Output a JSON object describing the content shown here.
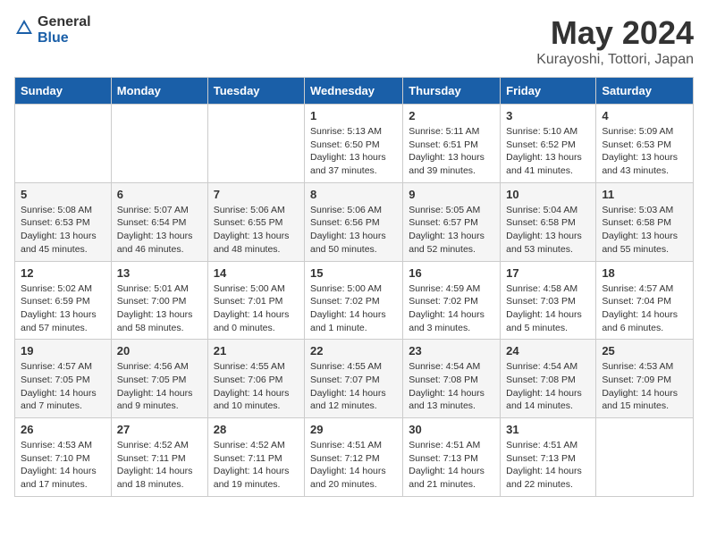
{
  "logo": {
    "general": "General",
    "blue": "Blue"
  },
  "header": {
    "month": "May 2024",
    "location": "Kurayoshi, Tottori, Japan"
  },
  "weekdays": [
    "Sunday",
    "Monday",
    "Tuesday",
    "Wednesday",
    "Thursday",
    "Friday",
    "Saturday"
  ],
  "weeks": [
    [
      {
        "day": "",
        "info": ""
      },
      {
        "day": "",
        "info": ""
      },
      {
        "day": "",
        "info": ""
      },
      {
        "day": "1",
        "info": "Sunrise: 5:13 AM\nSunset: 6:50 PM\nDaylight: 13 hours and 37 minutes."
      },
      {
        "day": "2",
        "info": "Sunrise: 5:11 AM\nSunset: 6:51 PM\nDaylight: 13 hours and 39 minutes."
      },
      {
        "day": "3",
        "info": "Sunrise: 5:10 AM\nSunset: 6:52 PM\nDaylight: 13 hours and 41 minutes."
      },
      {
        "day": "4",
        "info": "Sunrise: 5:09 AM\nSunset: 6:53 PM\nDaylight: 13 hours and 43 minutes."
      }
    ],
    [
      {
        "day": "5",
        "info": "Sunrise: 5:08 AM\nSunset: 6:53 PM\nDaylight: 13 hours and 45 minutes."
      },
      {
        "day": "6",
        "info": "Sunrise: 5:07 AM\nSunset: 6:54 PM\nDaylight: 13 hours and 46 minutes."
      },
      {
        "day": "7",
        "info": "Sunrise: 5:06 AM\nSunset: 6:55 PM\nDaylight: 13 hours and 48 minutes."
      },
      {
        "day": "8",
        "info": "Sunrise: 5:06 AM\nSunset: 6:56 PM\nDaylight: 13 hours and 50 minutes."
      },
      {
        "day": "9",
        "info": "Sunrise: 5:05 AM\nSunset: 6:57 PM\nDaylight: 13 hours and 52 minutes."
      },
      {
        "day": "10",
        "info": "Sunrise: 5:04 AM\nSunset: 6:58 PM\nDaylight: 13 hours and 53 minutes."
      },
      {
        "day": "11",
        "info": "Sunrise: 5:03 AM\nSunset: 6:58 PM\nDaylight: 13 hours and 55 minutes."
      }
    ],
    [
      {
        "day": "12",
        "info": "Sunrise: 5:02 AM\nSunset: 6:59 PM\nDaylight: 13 hours and 57 minutes."
      },
      {
        "day": "13",
        "info": "Sunrise: 5:01 AM\nSunset: 7:00 PM\nDaylight: 13 hours and 58 minutes."
      },
      {
        "day": "14",
        "info": "Sunrise: 5:00 AM\nSunset: 7:01 PM\nDaylight: 14 hours and 0 minutes."
      },
      {
        "day": "15",
        "info": "Sunrise: 5:00 AM\nSunset: 7:02 PM\nDaylight: 14 hours and 1 minute."
      },
      {
        "day": "16",
        "info": "Sunrise: 4:59 AM\nSunset: 7:02 PM\nDaylight: 14 hours and 3 minutes."
      },
      {
        "day": "17",
        "info": "Sunrise: 4:58 AM\nSunset: 7:03 PM\nDaylight: 14 hours and 5 minutes."
      },
      {
        "day": "18",
        "info": "Sunrise: 4:57 AM\nSunset: 7:04 PM\nDaylight: 14 hours and 6 minutes."
      }
    ],
    [
      {
        "day": "19",
        "info": "Sunrise: 4:57 AM\nSunset: 7:05 PM\nDaylight: 14 hours and 7 minutes."
      },
      {
        "day": "20",
        "info": "Sunrise: 4:56 AM\nSunset: 7:05 PM\nDaylight: 14 hours and 9 minutes."
      },
      {
        "day": "21",
        "info": "Sunrise: 4:55 AM\nSunset: 7:06 PM\nDaylight: 14 hours and 10 minutes."
      },
      {
        "day": "22",
        "info": "Sunrise: 4:55 AM\nSunset: 7:07 PM\nDaylight: 14 hours and 12 minutes."
      },
      {
        "day": "23",
        "info": "Sunrise: 4:54 AM\nSunset: 7:08 PM\nDaylight: 14 hours and 13 minutes."
      },
      {
        "day": "24",
        "info": "Sunrise: 4:54 AM\nSunset: 7:08 PM\nDaylight: 14 hours and 14 minutes."
      },
      {
        "day": "25",
        "info": "Sunrise: 4:53 AM\nSunset: 7:09 PM\nDaylight: 14 hours and 15 minutes."
      }
    ],
    [
      {
        "day": "26",
        "info": "Sunrise: 4:53 AM\nSunset: 7:10 PM\nDaylight: 14 hours and 17 minutes."
      },
      {
        "day": "27",
        "info": "Sunrise: 4:52 AM\nSunset: 7:11 PM\nDaylight: 14 hours and 18 minutes."
      },
      {
        "day": "28",
        "info": "Sunrise: 4:52 AM\nSunset: 7:11 PM\nDaylight: 14 hours and 19 minutes."
      },
      {
        "day": "29",
        "info": "Sunrise: 4:51 AM\nSunset: 7:12 PM\nDaylight: 14 hours and 20 minutes."
      },
      {
        "day": "30",
        "info": "Sunrise: 4:51 AM\nSunset: 7:13 PM\nDaylight: 14 hours and 21 minutes."
      },
      {
        "day": "31",
        "info": "Sunrise: 4:51 AM\nSunset: 7:13 PM\nDaylight: 14 hours and 22 minutes."
      },
      {
        "day": "",
        "info": ""
      }
    ]
  ]
}
